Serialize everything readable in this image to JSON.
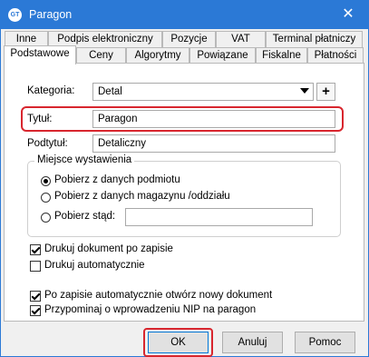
{
  "window": {
    "title": "Paragon",
    "icon": "app-logo-icon",
    "close": "close-icon",
    "close_glyph": "✕",
    "app_icon_text": "GT"
  },
  "tabs_row1": [
    {
      "label": "Inne"
    },
    {
      "label": "Podpis elektroniczny"
    },
    {
      "label": "Pozycje"
    },
    {
      "label": "VAT"
    },
    {
      "label": "Terminal płatniczy"
    }
  ],
  "tabs_row2": [
    {
      "label": "Podstawowe",
      "active": true
    },
    {
      "label": "Ceny"
    },
    {
      "label": "Algorytmy"
    },
    {
      "label": "Powiązane"
    },
    {
      "label": "Fiskalne"
    },
    {
      "label": "Płatności"
    }
  ],
  "form": {
    "kategoria_label": "Kategoria:",
    "kategoria_value": "Detal",
    "plus_label": "+",
    "tytul_label": "Tytuł:",
    "tytul_value": "Paragon",
    "podtytul_label": "Podtytuł:",
    "podtytul_value": "Detaliczny"
  },
  "miejsce": {
    "title": "Miejsce wystawienia",
    "opt1": "Pobierz z danych podmiotu",
    "opt2": "Pobierz z danych magazynu /oddziału",
    "opt3": "Pobierz stąd:",
    "opt3_value": "",
    "selected": 1
  },
  "checkboxes": {
    "druk_po_zapisie": {
      "label": "Drukuj dokument po zapisie",
      "checked": true
    },
    "druk_auto": {
      "label": "Drukuj automatycznie",
      "checked": false
    },
    "otworz_nowy": {
      "label": "Po zapisie automatycznie otwórz nowy dokument",
      "checked": true
    },
    "przypominaj_nip": {
      "label": "Przypominaj o wprowadzeniu NIP na paragon",
      "checked": true
    }
  },
  "buttons": {
    "ok": "OK",
    "cancel": "Anuluj",
    "help": "Pomoc"
  },
  "colors": {
    "titlebar": "#2b79d6",
    "highlight": "#d8262e",
    "default_button_border": "#0078d7"
  }
}
